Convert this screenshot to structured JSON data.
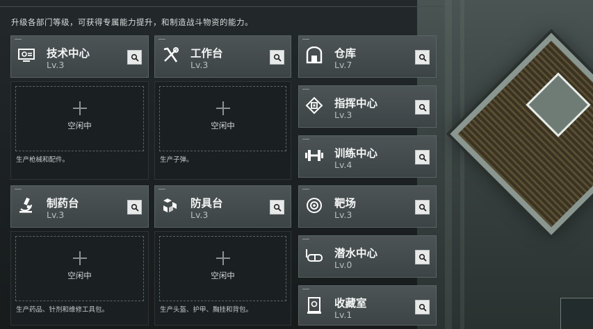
{
  "subtitle": "升级各部门等级，可获得专属能力提升，和制造战斗物资的能力。",
  "idle_label": "空闲中",
  "departments_left": [
    {
      "name": "技术中心",
      "level": "Lv.3",
      "icon": "monitor-gear-icon",
      "desc": "生产枪械和配件。"
    },
    {
      "name": "工作台",
      "level": "Lv.3",
      "icon": "hammer-wrench-icon",
      "desc": "生产子弹。"
    },
    {
      "name": "制药台",
      "level": "Lv.3",
      "icon": "microscope-icon",
      "desc": "生产药品、针剂和维修工具包。"
    },
    {
      "name": "防具台",
      "level": "Lv.3",
      "icon": "armor-boxes-icon",
      "desc": "生产头盔、护甲、胸挂和背包。"
    }
  ],
  "departments_right": [
    {
      "name": "仓库",
      "level": "Lv.7",
      "icon": "warehouse-icon"
    },
    {
      "name": "指挥中心",
      "level": "Lv.3",
      "icon": "chip-icon"
    },
    {
      "name": "训练中心",
      "level": "Lv.4",
      "icon": "dumbbell-icon"
    },
    {
      "name": "靶场",
      "level": "Lv.3",
      "icon": "target-icon"
    },
    {
      "name": "潜水中心",
      "level": "Lv.0",
      "icon": "diving-goggles-icon"
    },
    {
      "name": "收藏室",
      "level": "Lv.1",
      "icon": "trophy-case-icon"
    }
  ],
  "colors": {
    "card_bg": "#454c4e",
    "slot_bg": "#1a1f21",
    "text": "#f4f5f5"
  }
}
